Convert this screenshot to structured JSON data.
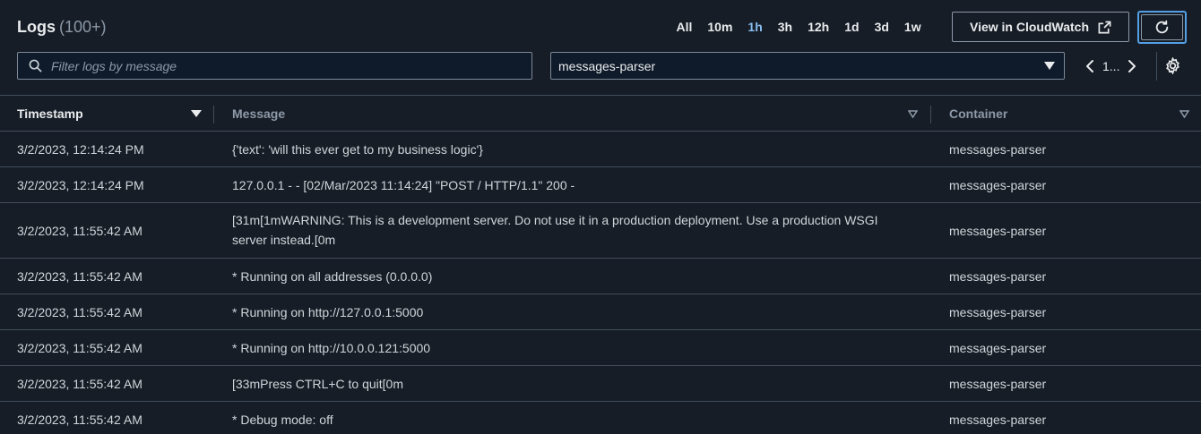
{
  "header": {
    "title": "Logs",
    "count": "(100+)",
    "ranges": [
      "All",
      "10m",
      "1h",
      "3h",
      "12h",
      "1d",
      "3d",
      "1w"
    ],
    "active_range": "1h",
    "cloudwatch_label": "View in CloudWatch"
  },
  "filters": {
    "search_placeholder": "Filter logs by message",
    "container_selected": "messages-parser",
    "page_label": "1..."
  },
  "table": {
    "columns": {
      "timestamp": "Timestamp",
      "message": "Message",
      "container": "Container"
    },
    "rows": [
      {
        "timestamp": "3/2/2023, 12:14:24 PM",
        "message": "{'text': 'will this ever get to my business logic'}",
        "container": "messages-parser"
      },
      {
        "timestamp": "3/2/2023, 12:14:24 PM",
        "message": "127.0.0.1 - - [02/Mar/2023 11:14:24] \"POST / HTTP/1.1\" 200 -",
        "container": "messages-parser"
      },
      {
        "timestamp": "3/2/2023, 11:55:42 AM",
        "message": "[31m[1mWARNING: This is a development server. Do not use it in a production deployment. Use a production WSGI server instead.[0m",
        "container": "messages-parser"
      },
      {
        "timestamp": "3/2/2023, 11:55:42 AM",
        "message": "* Running on all addresses (0.0.0.0)",
        "container": "messages-parser"
      },
      {
        "timestamp": "3/2/2023, 11:55:42 AM",
        "message": "* Running on http://127.0.0.1:5000",
        "container": "messages-parser"
      },
      {
        "timestamp": "3/2/2023, 11:55:42 AM",
        "message": "* Running on http://10.0.0.121:5000",
        "container": "messages-parser"
      },
      {
        "timestamp": "3/2/2023, 11:55:42 AM",
        "message": "[33mPress CTRL+C to quit[0m",
        "container": "messages-parser"
      },
      {
        "timestamp": "3/2/2023, 11:55:42 AM",
        "message": "* Debug mode: off",
        "container": "messages-parser"
      }
    ]
  },
  "colors": {
    "background": "#161d26",
    "accent": "#539fe5",
    "active_range": "#89bdee",
    "border": "#414d5c"
  }
}
